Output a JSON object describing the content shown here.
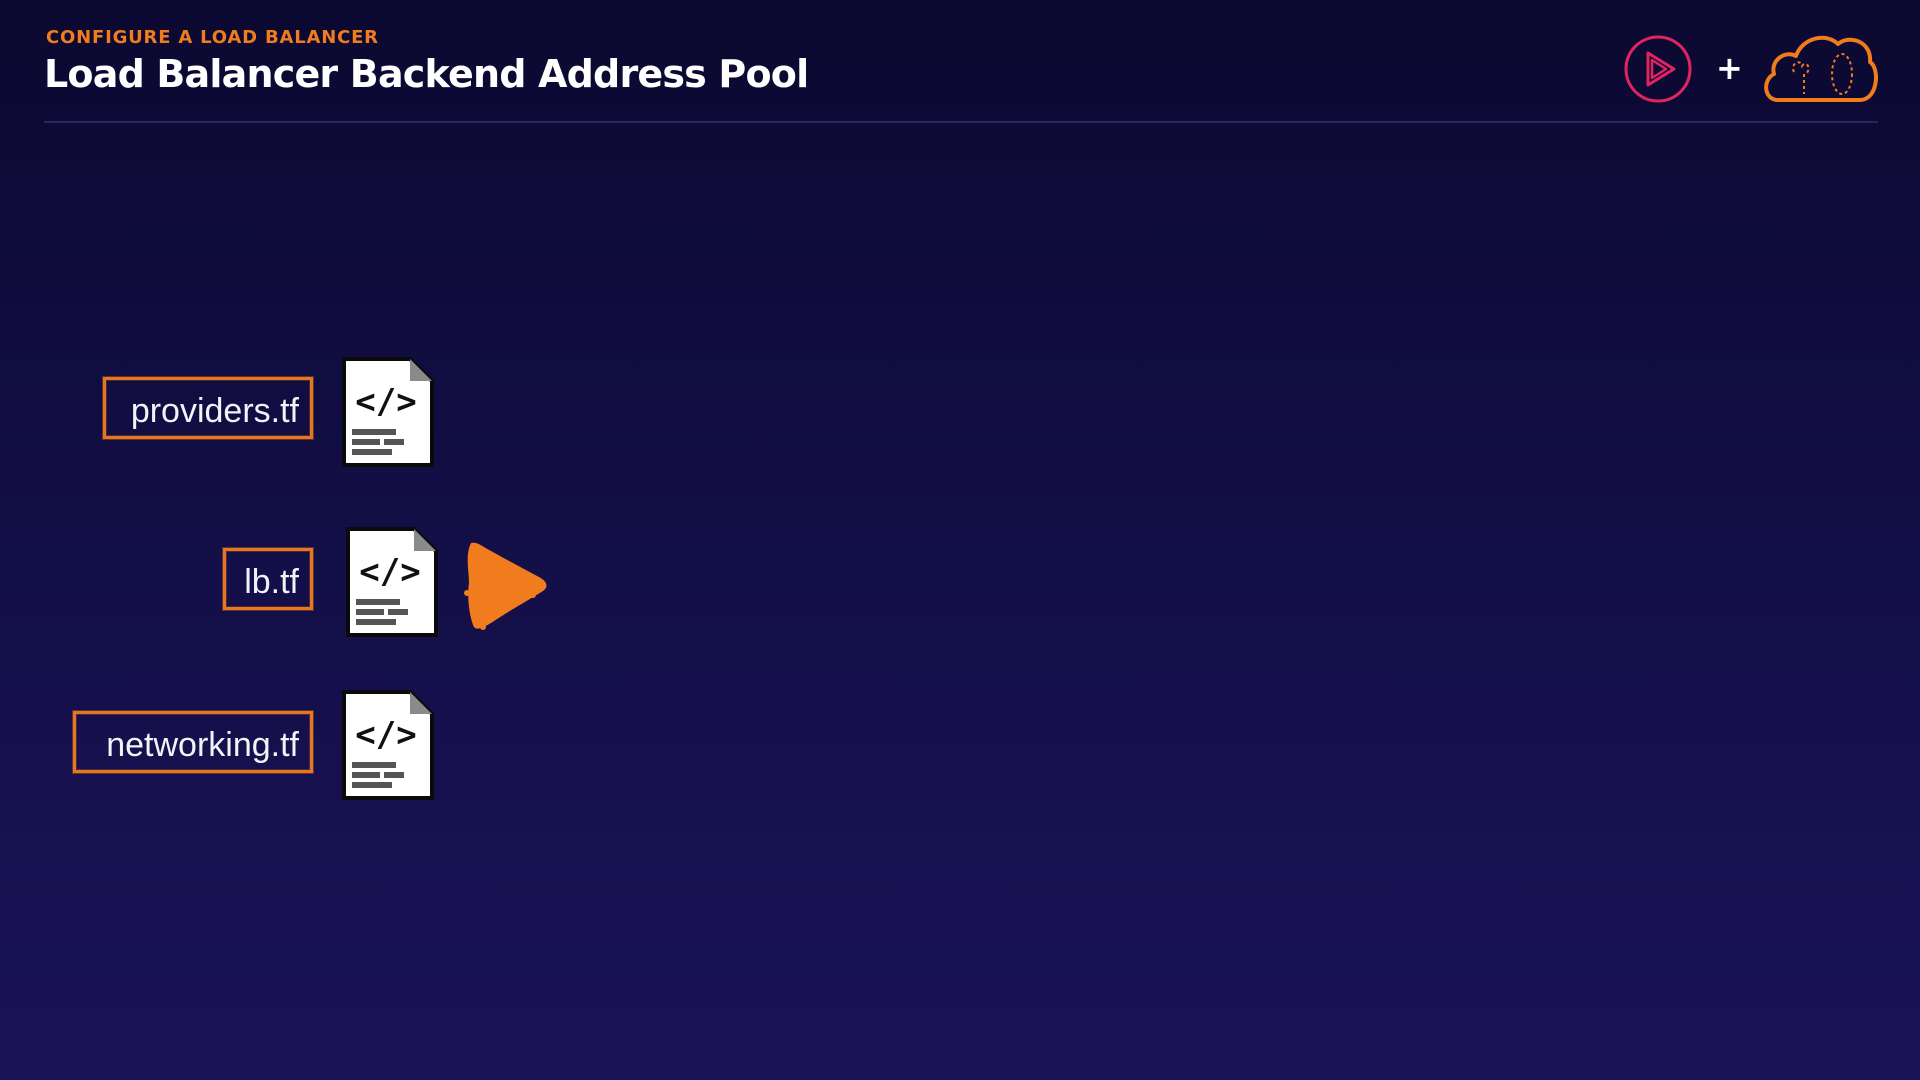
{
  "header": {
    "kicker": "CONFIGURE A LOAD BALANCER",
    "title": "Load Balancer Backend Address Pool",
    "logos": [
      "play-logo-icon",
      "plus-icon",
      "cloud-logo-icon"
    ],
    "plus": "+"
  },
  "files": [
    {
      "label": "providers.tf",
      "icon": "code-file-icon"
    },
    {
      "label": "lb.tf",
      "icon": "code-file-icon",
      "highlighted": true
    },
    {
      "label": "networking.tf",
      "icon": "code-file-icon"
    }
  ],
  "pointer": {
    "icon": "arrow-pointer-icon",
    "target": "lb.tf"
  },
  "colors": {
    "accent": "#f07c1e",
    "background_top": "#0b0930",
    "background_bottom": "#1a1457",
    "play_logo": "#e0245e",
    "text": "#ffffff"
  }
}
